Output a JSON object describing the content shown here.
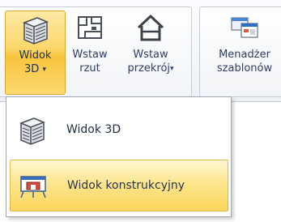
{
  "ribbon": {
    "buttons": [
      {
        "line1": "Widok",
        "line2": "3D",
        "has_arrow": true,
        "icon": "building-3d-icon",
        "active": true
      },
      {
        "line1": "Wstaw",
        "line2": "rzut",
        "has_arrow": false,
        "icon": "floor-plan-icon",
        "active": false
      },
      {
        "line1": "Wstaw",
        "line2": "przekrój",
        "has_arrow": true,
        "icon": "house-section-icon",
        "active": false
      },
      {
        "line1": "Menadżer",
        "line2": "szablonów",
        "has_arrow": false,
        "icon": "template-manager-icon",
        "active": false
      }
    ],
    "arrow_glyph": "▾"
  },
  "dropdown": {
    "items": [
      {
        "label": "Widok 3D",
        "icon": "building-3d-icon",
        "highlighted": false
      },
      {
        "label": "Widok konstrukcyjny",
        "icon": "construction-view-icon",
        "highlighted": true
      }
    ]
  },
  "colors": {
    "active_top": "#fde9a3",
    "active_bottom": "#f8c53d",
    "label_text": "#2c3e66",
    "menu_border": "#9ea7b3"
  }
}
